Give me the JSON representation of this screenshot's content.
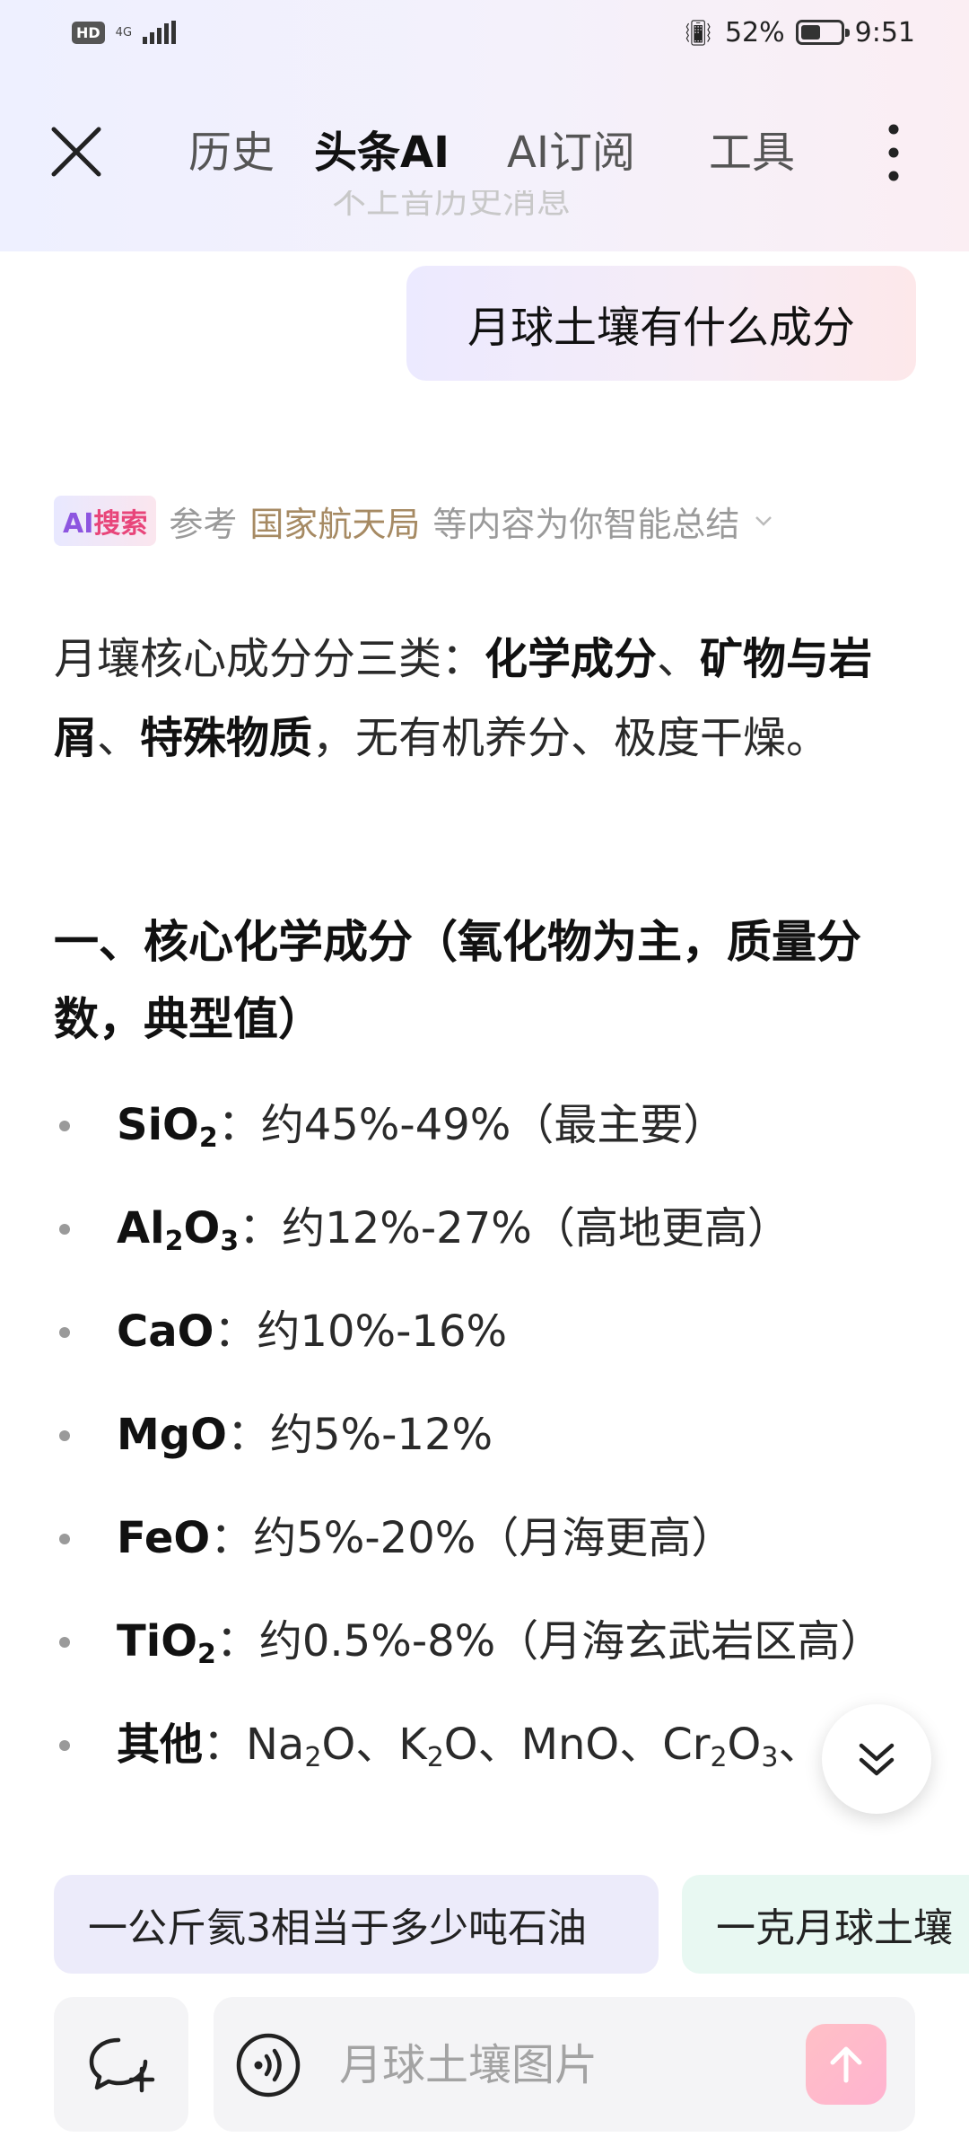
{
  "status_bar": {
    "hd": "HD",
    "network": "4G",
    "battery": "52%",
    "battery_level": 0.52,
    "time": "9:51"
  },
  "header": {
    "tabs": [
      {
        "label": "历史",
        "active": false
      },
      {
        "label": "头条AI",
        "active": true
      },
      {
        "label": "AI订阅",
        "active": false
      },
      {
        "label": "工具",
        "active": false
      }
    ]
  },
  "conversation": {
    "faded_previous": "不上音历史消息",
    "user_message": "月球土壤有什么成分",
    "source": {
      "badge_ai": "AI",
      "badge_search": "搜索",
      "prefix": "参考",
      "link": "国家航天局",
      "suffix": "等内容为你智能总结"
    },
    "answer": {
      "intro_start": "月壤核心成分分三类：",
      "cat1": "化学成分",
      "sep1": "、",
      "cat2": "矿物与岩屑",
      "sep2": "、",
      "cat3": "特殊物质",
      "intro_end": "，无有机养分、极度干燥。",
      "section_title": "一、核心化学成分（氧化物为主，质量分数，典型值）",
      "items": [
        {
          "formula_base": "SiO",
          "formula_sub": "2",
          "text": "：约45%-49%（最主要）"
        },
        {
          "formula_base1": "Al",
          "formula_sub1": "2",
          "formula_base2": "O",
          "formula_sub2": "3",
          "text": "：约12%-27%（高地更高）"
        },
        {
          "formula": "CaO",
          "text": "：约10%-16%"
        },
        {
          "formula": "MgO",
          "text": "：约5%-12%"
        },
        {
          "formula": "FeO",
          "text": "：约5%-20%（月海更高）"
        },
        {
          "formula_base": "TiO",
          "formula_sub": "2",
          "text": "：约0.5%-8%（月海玄武岩区高）"
        },
        {
          "formula": "其他",
          "text_a": "：Na",
          "sub_a": "2",
          "text_b": "O、K",
          "sub_b": "2",
          "text_c": "O、MnO、Cr",
          "sub_c": "2",
          "text_d": "O",
          "sub_d": "3",
          "text_e": "、"
        }
      ]
    }
  },
  "suggestions": [
    "一公斤氦3相当于多少吨石油",
    "一克月球土壤"
  ],
  "input": {
    "placeholder": "月球土壤图片"
  },
  "colors": {
    "accent_purple": "#8d55e0",
    "accent_pink": "#e8457a",
    "source_link": "#a68a63",
    "send_button": "#ffb3d0"
  },
  "icons": [
    "close-icon",
    "more-vertical-icon",
    "chevron-down-icon",
    "double-chevron-down-icon",
    "new-chat-icon",
    "voice-icon",
    "send-arrow-icon"
  ]
}
